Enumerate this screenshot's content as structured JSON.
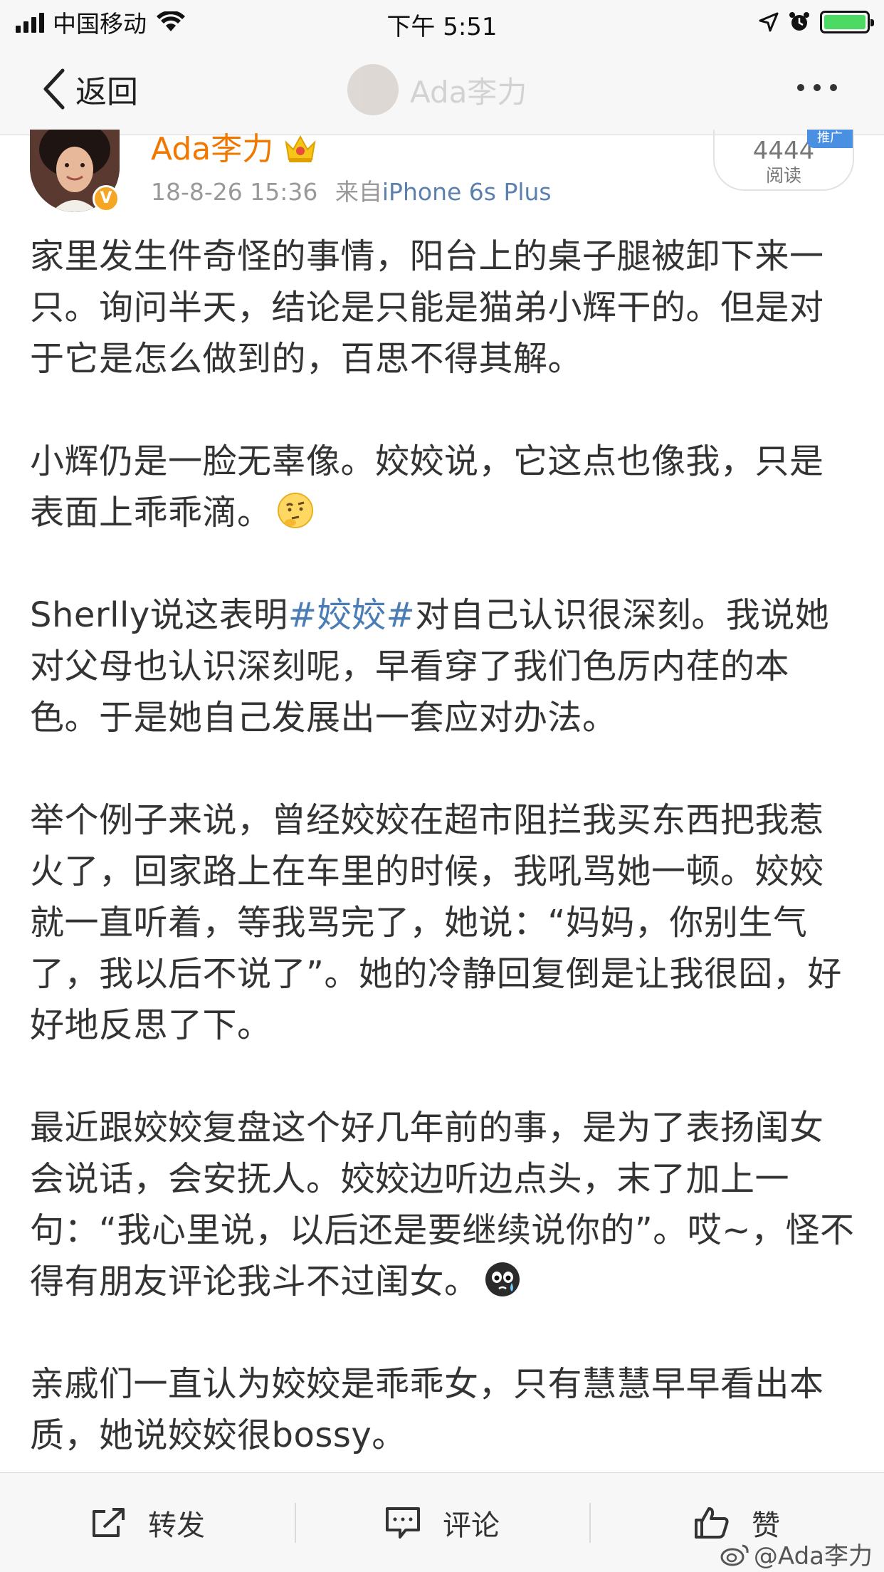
{
  "status_bar": {
    "carrier": "中国移动",
    "time": "下午 5:51"
  },
  "nav": {
    "back_label": "返回",
    "title": "Ada李力"
  },
  "author": {
    "name": "Ada李力",
    "verified_badge": "V",
    "date": "18-8-26 15:36",
    "source_prefix": "来自",
    "source_device": "iPhone 6s Plus"
  },
  "read_box": {
    "count": "4444",
    "label": "阅读",
    "tag": "推广"
  },
  "post": {
    "p1": "家里发生件奇怪的事情，阳台上的桌子腿被卸下来一只。询问半天，结论是只能是猫弟小辉干的。但是对于它是怎么做到的，百思不得其解。",
    "p2": "小辉仍是一脸无辜像。姣姣说，它这点也像我，只是表面上乖乖滴。",
    "p3_before": "Sherlly说这表明",
    "p3_hashtag": "#姣姣#",
    "p3_after": "对自己认识很深刻。我说她对父母也认识深刻呢，早看穿了我们色厉内荏的本色。于是她自己发展出一套应对办法。",
    "p4": "举个例子来说，曾经姣姣在超市阻拦我买东西把我惹火了，回家路上在车里的时候，我吼骂她一顿。姣姣就一直听着，等我骂完了，她说：“妈妈，你别生气了，我以后不说了”。她的冷静回复倒是让我很囧，好好地反思了下。",
    "p5": "最近跟姣姣复盘这个好几年前的事，是为了表扬闺女会说话，会安抚人。姣姣边听边点头，末了加上一句：“我心里说，以后还是要继续说你的”。哎~，怪不得有朋友评论我斗不过闺女。",
    "p6": "亲戚们一直认为姣姣是乖乖女，只有慧慧早早看出本质，她说姣姣很bossy。"
  },
  "toolbar": {
    "repost": "转发",
    "comment": "评论",
    "like": "赞"
  },
  "watermark": "@Ada李力",
  "icons": {
    "p2_emoji": "thinking-emoji-icon",
    "p5_emoji": "crying-emoji-icon"
  },
  "colors": {
    "author_name": "#f07800",
    "link": "#4a7cb5",
    "meta": "#999999"
  }
}
